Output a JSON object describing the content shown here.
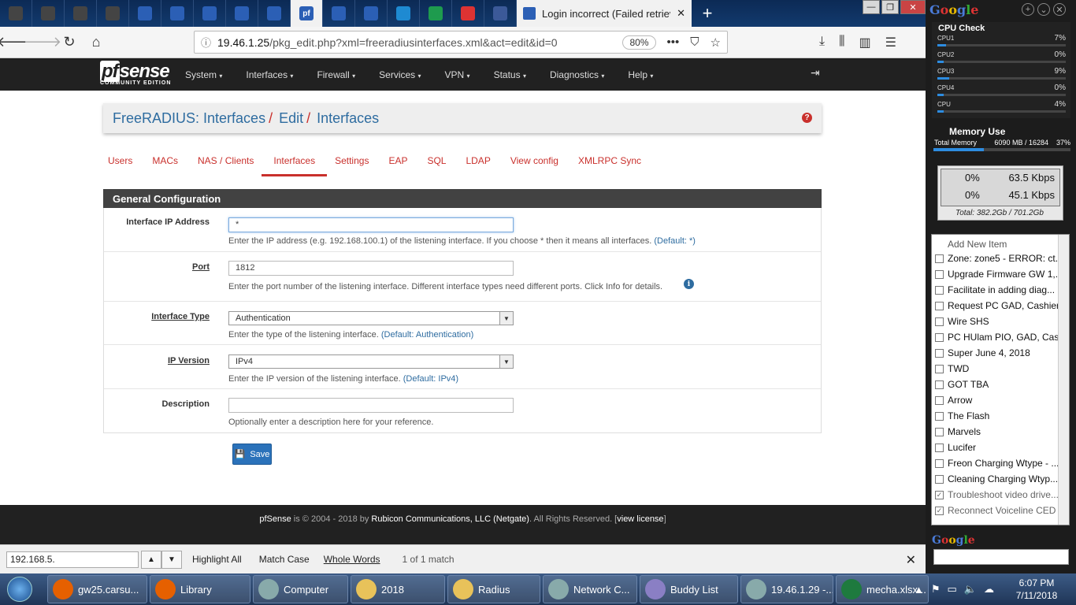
{
  "browser": {
    "pinned_tabs": [
      {
        "name": "tab-wolf-1",
        "color": "#444"
      },
      {
        "name": "tab-wolf-2",
        "color": "#444"
      },
      {
        "name": "tab-wolf-3",
        "color": "#444"
      },
      {
        "name": "tab-wolf-4",
        "color": "#444"
      },
      {
        "name": "tab-blue-1",
        "color": "#2b5fb5"
      },
      {
        "name": "tab-blue-2",
        "color": "#2b5fb5"
      },
      {
        "name": "tab-blue-3",
        "color": "#2b5fb5"
      },
      {
        "name": "tab-blue-4",
        "color": "#2b5fb5"
      },
      {
        "name": "tab-blue-5",
        "color": "#2b5fb5"
      },
      {
        "name": "tab-pfsense",
        "color": "#2b5fb5"
      },
      {
        "name": "tab-blue-6",
        "color": "#2b5fb5"
      },
      {
        "name": "tab-blue-7",
        "color": "#2b5fb5"
      },
      {
        "name": "tab-drupal",
        "color": "#1e8ad2"
      },
      {
        "name": "tab-sheets",
        "color": "#1e9b4e"
      },
      {
        "name": "tab-gmail",
        "color": "#d33"
      },
      {
        "name": "tab-facebook",
        "color": "#3b5998"
      }
    ],
    "pfsense_tab_glyph": "pf",
    "current_tab_title": "Login incorrect (Failed retrievin",
    "close_glyph": "✕",
    "new_tab_glyph": "+",
    "url_host": "19.46.1.25",
    "url_path": "/pkg_edit.php?xml=freeradiusinterfaces.xml&act=edit&id=0",
    "zoom": "80%"
  },
  "pfsense": {
    "logo": "pfsense",
    "edition": "COMMUNITY EDITION",
    "menu": [
      "System",
      "Interfaces",
      "Firewall",
      "Services",
      "VPN",
      "Status",
      "Diagnostics",
      "Help"
    ],
    "breadcrumb": [
      "FreeRADIUS: Interfaces",
      "Edit",
      "Interfaces"
    ],
    "subtabs": [
      "Users",
      "MACs",
      "NAS / Clients",
      "Interfaces",
      "Settings",
      "EAP",
      "SQL",
      "LDAP",
      "View config",
      "XMLRPC Sync"
    ],
    "active_subtab": "Interfaces",
    "section_title": "General Configuration",
    "fields": {
      "ip_label": "Interface IP Address",
      "ip_value": "*",
      "ip_help": "Enter the IP address (e.g. 192.168.100.1) of the listening interface. If you choose * then it means all interfaces.",
      "ip_default": "(Default: *)",
      "port_label": "Port",
      "port_value": "1812",
      "port_help": "Enter the port number of the listening interface. Different interface types need different ports. Click Info for details.",
      "type_label": "Interface Type",
      "type_value": "Authentication",
      "type_help": "Enter the type of the listening interface.",
      "type_default": "(Default: Authentication)",
      "ipver_label": "IP Version",
      "ipver_value": "IPv4",
      "ipver_help": "Enter the IP version of the listening interface.",
      "ipver_default": "(Default: IPv4)",
      "desc_label": "Description",
      "desc_value": "",
      "desc_help": "Optionally enter a description here for your reference."
    },
    "save_label": "Save",
    "footer": {
      "brand": "pfSense",
      "mid": " is © 2004 - 2018 by ",
      "company": "Rubicon Communications, LLC (Netgate)",
      "rights": ". All Rights Reserved. [",
      "license": "view license",
      "end": "]"
    }
  },
  "findbar": {
    "query": "192.168.5.",
    "highlight_all": "Highlight All",
    "match_case": "Match Case",
    "whole_words": "Whole Words",
    "result": "1 of 1 match"
  },
  "taskbar": {
    "items": [
      {
        "label": "gw25.carsu...",
        "color": "#e66000"
      },
      {
        "label": "Library",
        "color": "#e66000"
      },
      {
        "label": "Computer",
        "color": "#8aa"
      },
      {
        "label": "2018",
        "color": "#e8c25a"
      },
      {
        "label": "Radius",
        "color": "#e8c25a"
      },
      {
        "label": "Network C...",
        "color": "#8aa"
      },
      {
        "label": "Buddy List",
        "color": "#8a7fc4"
      },
      {
        "label": "19.46.1.29 -...",
        "color": "#8aa"
      },
      {
        "label": "mecha.xlsx...",
        "color": "#1e7a3e"
      }
    ],
    "time": "6:07 PM",
    "date": "7/11/2018"
  },
  "sidebar": {
    "google": "Google",
    "cpu_title": "CPU Check",
    "cpus": [
      {
        "name": "CPU1",
        "pct": "7%",
        "level": 0.07
      },
      {
        "name": "CPU2",
        "pct": "0%",
        "level": 0.0
      },
      {
        "name": "CPU3",
        "pct": "9%",
        "level": 0.09
      },
      {
        "name": "CPU4",
        "pct": "0%",
        "level": 0.0
      },
      {
        "name": "CPU",
        "pct": "4%",
        "level": 0.04
      }
    ],
    "mem_title": "Memory Use",
    "mem_label": "Total Memory",
    "mem_value": "6090 MB / 16284",
    "mem_pct": "37%",
    "net_up_pct": "0%",
    "net_up": "63.5 Kbps",
    "net_down_pct": "0%",
    "net_down": "45.1 Kbps",
    "net_total": "Total: 382.2Gb / 701.2Gb",
    "todo_add": "Add New Item",
    "todo": [
      {
        "text": "Zone: zone5 - ERROR: ct...",
        "done": false
      },
      {
        "text": "Upgrade Firmware GW 1,...",
        "done": false
      },
      {
        "text": "Facilitate in adding diag...",
        "done": false
      },
      {
        "text": "Request PC GAD, Cashier...",
        "done": false
      },
      {
        "text": "Wire SHS",
        "done": false
      },
      {
        "text": "PC HUlam PIO, GAD, Cas...",
        "done": false
      },
      {
        "text": "Super June 4, 2018",
        "done": false
      },
      {
        "text": "TWD",
        "done": false
      },
      {
        "text": "GOT TBA",
        "done": false
      },
      {
        "text": "Arrow",
        "done": false
      },
      {
        "text": "The Flash",
        "done": false
      },
      {
        "text": "Marvels",
        "done": false
      },
      {
        "text": "Lucifer",
        "done": false
      },
      {
        "text": "Freon Charging Wtype - ...",
        "done": false
      },
      {
        "text": "Cleaning Charging Wtyp...",
        "done": false
      },
      {
        "text": "Troubleshoot video drive...",
        "done": true
      },
      {
        "text": "Reconnect Voiceline CED",
        "done": true
      }
    ]
  }
}
